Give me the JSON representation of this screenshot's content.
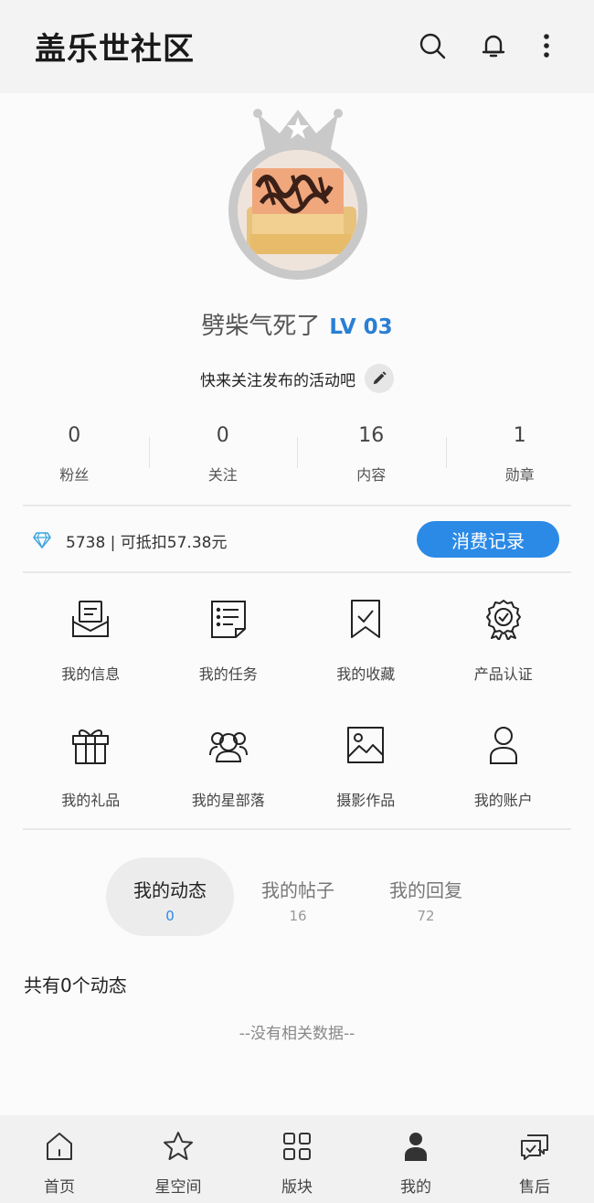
{
  "header": {
    "title": "盖乐世社区",
    "icons": [
      "search-icon",
      "bell-icon",
      "more-vertical-icon"
    ]
  },
  "profile": {
    "avatar": "avatar-image",
    "username": "劈柴气死了",
    "level": "LV 03",
    "bio": "快来关注发布的活动吧"
  },
  "stats": [
    {
      "num": "0",
      "label": "粉丝"
    },
    {
      "num": "0",
      "label": "关注"
    },
    {
      "num": "16",
      "label": "内容"
    },
    {
      "num": "1",
      "label": "勋章"
    }
  ],
  "points": {
    "text": "5738 | 可抵扣57.38元",
    "button": "消费记录",
    "accent": "#2b8ae6"
  },
  "grid": [
    {
      "label": "我的信息",
      "icon": "message-icon"
    },
    {
      "label": "我的任务",
      "icon": "task-list-icon"
    },
    {
      "label": "我的收藏",
      "icon": "bookmark-icon"
    },
    {
      "label": "产品认证",
      "icon": "badge-certificate-icon"
    },
    {
      "label": "我的礼品",
      "icon": "gift-icon"
    },
    {
      "label": "我的星部落",
      "icon": "group-icon"
    },
    {
      "label": "摄影作品",
      "icon": "image-icon"
    },
    {
      "label": "我的账户",
      "icon": "user-icon"
    }
  ],
  "tabs": [
    {
      "label": "我的动态",
      "count": "0"
    },
    {
      "label": "我的帖子",
      "count": "16"
    },
    {
      "label": "我的回复",
      "count": "72"
    }
  ],
  "feed": {
    "count_text": "共有0个动态",
    "empty_text": "--没有相关数据--"
  },
  "bottom_nav": [
    {
      "label": "首页",
      "icon": "home-icon"
    },
    {
      "label": "星空间",
      "icon": "star-icon"
    },
    {
      "label": "版块",
      "icon": "grid-icon"
    },
    {
      "label": "我的",
      "icon": "person-icon"
    },
    {
      "label": "售后",
      "icon": "chat-check-icon"
    }
  ]
}
